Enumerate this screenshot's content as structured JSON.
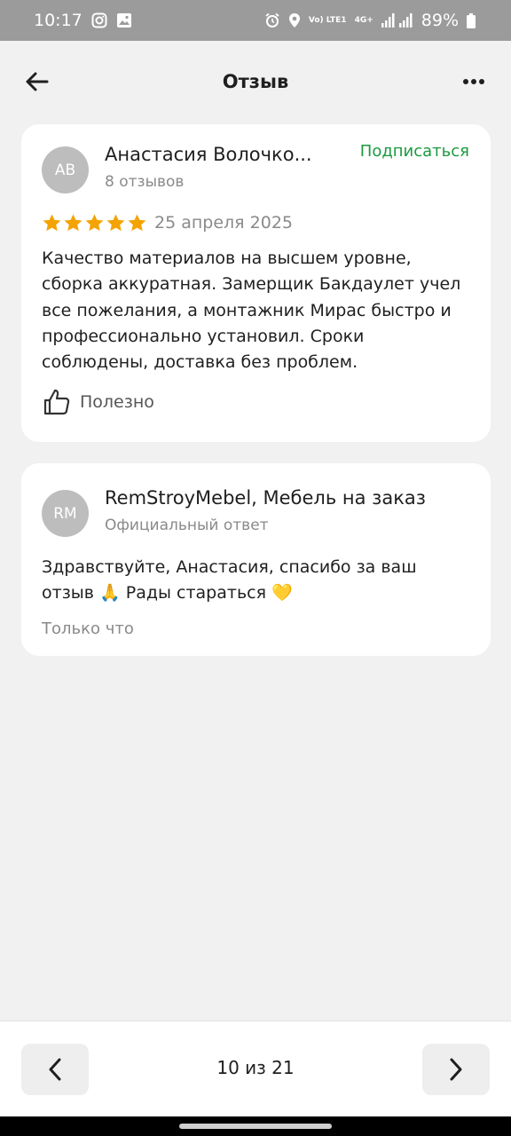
{
  "status_bar": {
    "time": "10:17",
    "battery": "89%",
    "icons": [
      "instagram-icon",
      "gallery-icon",
      "alarm-icon",
      "location-icon",
      "volte-icon",
      "4g-icon",
      "signal-icon",
      "battery-icon"
    ],
    "volte_label": "Vo) LTE1",
    "network_label": "4G+"
  },
  "app_bar": {
    "title": "Отзыв",
    "back_icon": "arrow-left-icon",
    "more_icon": "more-dots-icon"
  },
  "review": {
    "avatar_initials": "AB",
    "author_name": "Анастасия Волочко...",
    "reviews_count": "8 отзывов",
    "subscribe_label": "Подписаться",
    "rating": 5,
    "rating_max": 5,
    "date": "25 апреля 2025",
    "text": "Качество материалов на высшем уровне, сборка аккуратная. Замерщик Бакдаулет учел все пожелания, а монтажник Мирас быстро и профессионально установил. Сроки соблюдены, доставка без проблем.",
    "useful_label": "Полезно"
  },
  "reply": {
    "avatar_initials": "RM",
    "author_name": "RemStroyMebel, Мебель на заказ",
    "subtitle": "Официальный ответ",
    "text": "Здравствуйте, Анастасия, спасибо за ваш отзыв 🙏 Рады стараться 💛",
    "time": "Только что"
  },
  "pagination": {
    "label": "10 из 21",
    "prev_icon": "chevron-left-icon",
    "next_icon": "chevron-right-icon"
  },
  "colors": {
    "accent_green": "#1a9a3f",
    "star": "#f4a300",
    "avatar_bg": "#bdbdbd",
    "background": "#f1f1f1"
  }
}
